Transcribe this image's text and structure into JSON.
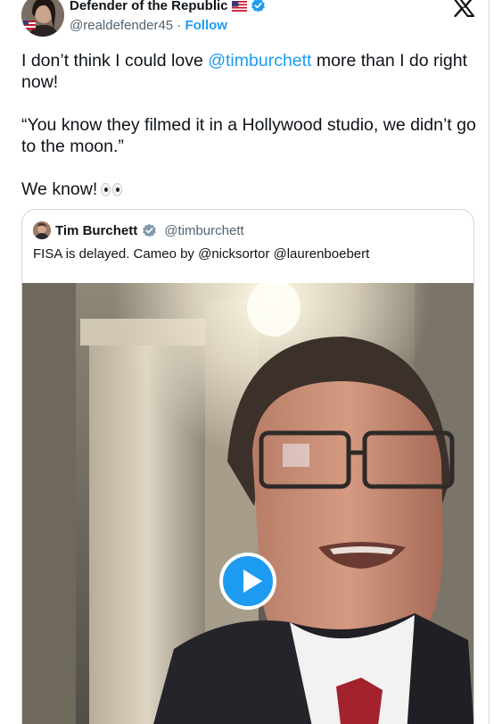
{
  "author": {
    "display_name": "Defender of the Republic",
    "flag_icon": "us-flag-icon",
    "handle": "@realdefender45",
    "separator": "·",
    "follow_label": "Follow"
  },
  "platform_icon": "x-logo-icon",
  "tweet": {
    "line1_before": "I don’t think I could love ",
    "line1_mention": "@timburchett",
    "line1_after": " more than I do right now!",
    "line2": "“You know they filmed it in a Hollywood studio, we didn’t go to the moon.”",
    "line3": "We know!",
    "line3_emoji": "eyes-emoji"
  },
  "quoted_tweet": {
    "display_name": "Tim Burchett",
    "handle": "@timburchett",
    "text": "FISA is delayed. Cameo by @nicksortor @laurenboebert",
    "media_type": "video",
    "play_icon": "play-icon"
  },
  "colors": {
    "accent": "#1d9bf0",
    "text": "#0f1419",
    "secondary": "#536471",
    "border": "#cfd9de"
  }
}
